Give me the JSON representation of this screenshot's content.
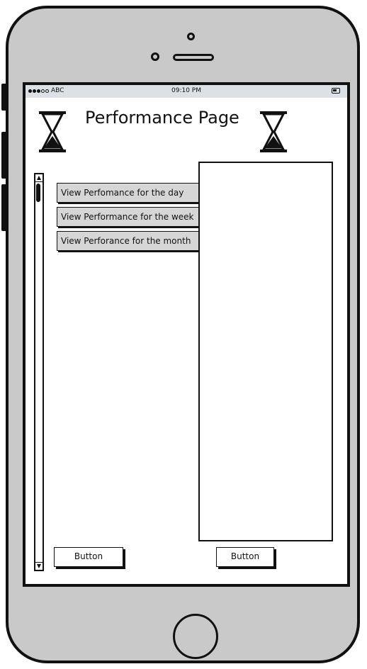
{
  "status_bar": {
    "carrier": "ABC",
    "time": "09:10 PM"
  },
  "page": {
    "title": "Performance Page"
  },
  "menu": {
    "items": [
      {
        "label": "View Perfomance for the day"
      },
      {
        "label": "View Performance for the week"
      },
      {
        "label": "View Perforance for the month"
      }
    ]
  },
  "footer": {
    "left_button": "Button",
    "right_button": "Button"
  },
  "icons": {
    "title_left": "hourglass-icon",
    "title_right": "hourglass-icon",
    "battery": "battery-icon"
  },
  "colors": {
    "device_body": "#c9c9c9",
    "status_bar": "#dde1e5",
    "menu_item_fill": "#d6d6d6"
  }
}
